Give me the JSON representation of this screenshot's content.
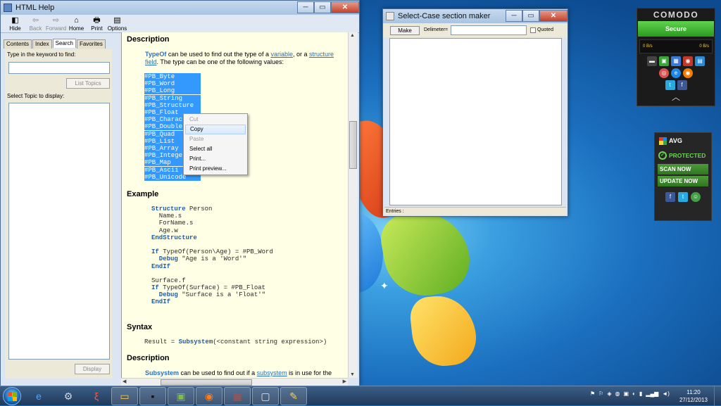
{
  "help_window": {
    "title": "HTML Help",
    "toolbar": [
      {
        "label": "Hide",
        "icon": "hide-icon",
        "glyph": "◧",
        "enabled": true
      },
      {
        "label": "Back",
        "icon": "back-arrow-icon",
        "glyph": "⇦",
        "enabled": false
      },
      {
        "label": "Forward",
        "icon": "forward-arrow-icon",
        "glyph": "⇨",
        "enabled": false
      },
      {
        "label": "Home",
        "icon": "home-icon",
        "glyph": "⌂",
        "enabled": true
      },
      {
        "label": "Print",
        "icon": "printer-icon",
        "glyph": "🖶",
        "enabled": true
      },
      {
        "label": "Options",
        "icon": "options-icon",
        "glyph": "▤",
        "enabled": true
      }
    ],
    "nav_tabs": [
      "Contents",
      "Index",
      "Search",
      "Favorites"
    ],
    "active_tab": "Search",
    "keyword_label": "Type in the keyword to find:",
    "list_topics_label": "List Topics",
    "select_topic_label": "Select Topic to display:",
    "display_label": "Display",
    "content": {
      "description_heading": "Description",
      "typeof_keyword": "TypeOf",
      "desc_text_1": " can be used to find out the type of a ",
      "link_variable": "variable",
      "desc_text_2": ", or a ",
      "link_structure": "structure field",
      "desc_text_3": ". The type can be one of the following values:",
      "type_values": [
        "#PB_Byte",
        "#PB_Word",
        "#PB_Long",
        "#PB_String",
        "#PB_Structure",
        "#PB_Float",
        "#PB_Character",
        "#PB_Double",
        "#PB_Quad",
        "#PB_List",
        "#PB_Array",
        "#PB_Integer",
        "#PB_Map",
        "#PB_Ascii",
        "#PB_Unicode"
      ],
      "example_heading": "Example",
      "example_code": [
        {
          "kw": "Structure",
          "rest": " Person"
        },
        {
          "kw": "",
          "rest": "  Name.s"
        },
        {
          "kw": "",
          "rest": "  ForName.s"
        },
        {
          "kw": "",
          "rest": "  Age.w"
        },
        {
          "kw": "EndStructure",
          "rest": ""
        },
        {
          "kw": "",
          "rest": ""
        },
        {
          "kw": "If",
          "rest": " TypeOf(Person\\Age) = #PB_Word"
        },
        {
          "kw": "  Debug",
          "rest": " \"Age is a 'Word'\""
        },
        {
          "kw": "EndIf",
          "rest": ""
        },
        {
          "kw": "",
          "rest": ""
        },
        {
          "kw": "",
          "rest": "Surface.f"
        },
        {
          "kw": "If",
          "rest": " TypeOf(Surface) = #PB_Float"
        },
        {
          "kw": "  Debug",
          "rest": " \"Surface is a 'Float'\""
        },
        {
          "kw": "EndIf",
          "rest": ""
        }
      ],
      "syntax_heading": "Syntax",
      "syntax_result": "Result = ",
      "syntax_kw": "Subsystem",
      "syntax_rest": "(<constant string expression>)",
      "description2_heading": "Description",
      "desc2_kw": "Subsystem",
      "desc2_text": " can be used to find out if a ",
      "desc2_link": "subsystem",
      "desc2_text2": " is in use for the"
    },
    "context_menu": [
      {
        "label": "Cut",
        "enabled": false,
        "highlight": false
      },
      {
        "label": "Copy",
        "enabled": true,
        "highlight": true
      },
      {
        "label": "Paste",
        "enabled": false,
        "highlight": false
      },
      {
        "label": "Select all",
        "enabled": true,
        "highlight": false
      },
      {
        "label": "Print...",
        "enabled": true,
        "highlight": false
      },
      {
        "label": "Print preview...",
        "enabled": true,
        "highlight": false
      }
    ]
  },
  "select_case_window": {
    "title": "Select-Case  section maker",
    "make_label": "Make",
    "delimeter_label": "Delimeter=",
    "delimeter_value": "",
    "quoted_label": "Quoted",
    "quoted_checked": false,
    "status_label": "Entries :"
  },
  "comodo": {
    "title": "COMODO",
    "status": "Secure",
    "traffic_in": "0 B/s",
    "traffic_out": "0 B/s"
  },
  "avg": {
    "title": "AVG",
    "protected_label": "PROTECTED",
    "scan_now_label": "SCAN NOW",
    "update_now_label": "UPDATE NOW"
  },
  "taskbar": {
    "clock_time": "11:20",
    "clock_date": "27/12/2013",
    "apps": [
      {
        "name": "internet-explorer-icon",
        "glyph": "e",
        "color": "#4aa4ff",
        "open": false
      },
      {
        "name": "settings-gear-icon",
        "glyph": "⚙",
        "color": "#cfd8e3",
        "open": false
      },
      {
        "name": "purebasic-icon",
        "glyph": "ξ",
        "color": "#ff5a3c",
        "open": false
      },
      {
        "name": "explorer-folder-icon",
        "glyph": "▭",
        "color": "#f2c94c",
        "open": true
      },
      {
        "name": "command-prompt-icon",
        "glyph": "▪",
        "color": "#111111",
        "open": true
      },
      {
        "name": "image-viewer-icon",
        "glyph": "▣",
        "color": "#7bc043",
        "open": true
      },
      {
        "name": "firefox-icon",
        "glyph": "◉",
        "color": "#ff7a1a",
        "open": true
      },
      {
        "name": "window-app-icon",
        "glyph": "▦",
        "color": "#d6412b",
        "open": true
      },
      {
        "name": "help-app-icon",
        "glyph": "▢",
        "color": "#e8e8e8",
        "open": true
      },
      {
        "name": "paint-icon",
        "glyph": "✎",
        "color": "#ffd24a",
        "open": true
      }
    ]
  }
}
